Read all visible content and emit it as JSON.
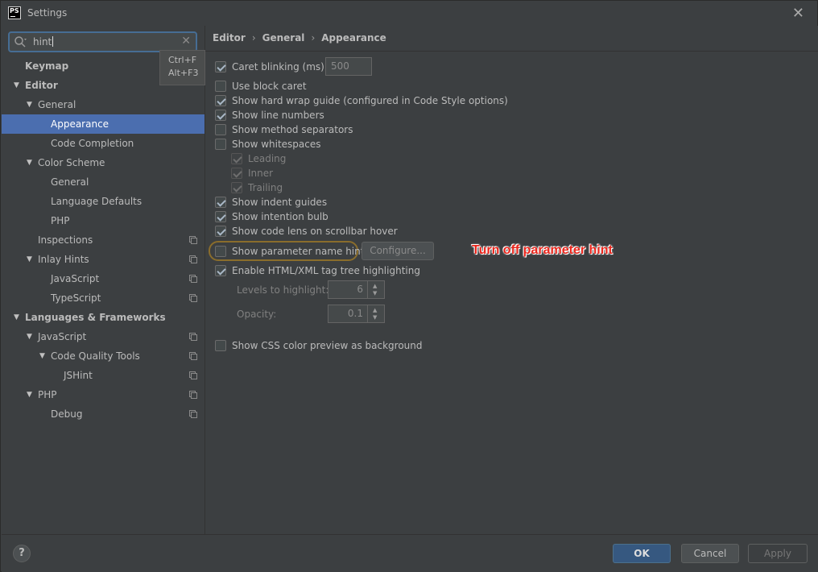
{
  "window": {
    "title": "Settings",
    "app_icon_text": "PS"
  },
  "search": {
    "value": "hint",
    "shortcut_1": "Ctrl+F",
    "shortcut_2": "Alt+F3"
  },
  "tree": [
    {
      "label": "Keymap",
      "depth": 0,
      "bold": true,
      "arrow": "",
      "copy": false,
      "selected": false
    },
    {
      "label": "Editor",
      "depth": 0,
      "bold": true,
      "arrow": "down",
      "copy": false,
      "selected": false
    },
    {
      "label": "General",
      "depth": 1,
      "bold": false,
      "arrow": "down",
      "copy": false,
      "selected": false
    },
    {
      "label": "Appearance",
      "depth": 2,
      "bold": false,
      "arrow": "",
      "copy": false,
      "selected": true
    },
    {
      "label": "Code Completion",
      "depth": 2,
      "bold": false,
      "arrow": "",
      "copy": false,
      "selected": false
    },
    {
      "label": "Color Scheme",
      "depth": 1,
      "bold": false,
      "arrow": "down",
      "copy": false,
      "selected": false
    },
    {
      "label": "General",
      "depth": 2,
      "bold": false,
      "arrow": "",
      "copy": false,
      "selected": false
    },
    {
      "label": "Language Defaults",
      "depth": 2,
      "bold": false,
      "arrow": "",
      "copy": false,
      "selected": false
    },
    {
      "label": "PHP",
      "depth": 2,
      "bold": false,
      "arrow": "",
      "copy": false,
      "selected": false
    },
    {
      "label": "Inspections",
      "depth": 1,
      "bold": false,
      "arrow": "",
      "copy": true,
      "selected": false
    },
    {
      "label": "Inlay Hints",
      "depth": 1,
      "bold": false,
      "arrow": "down",
      "copy": true,
      "selected": false
    },
    {
      "label": "JavaScript",
      "depth": 2,
      "bold": false,
      "arrow": "",
      "copy": true,
      "selected": false
    },
    {
      "label": "TypeScript",
      "depth": 2,
      "bold": false,
      "arrow": "",
      "copy": true,
      "selected": false
    },
    {
      "label": "Languages & Frameworks",
      "depth": 0,
      "bold": true,
      "arrow": "down",
      "copy": false,
      "selected": false
    },
    {
      "label": "JavaScript",
      "depth": 1,
      "bold": false,
      "arrow": "down",
      "copy": true,
      "selected": false
    },
    {
      "label": "Code Quality Tools",
      "depth": 2,
      "bold": false,
      "arrow": "down",
      "copy": true,
      "selected": false
    },
    {
      "label": "JSHint",
      "depth": 3,
      "bold": false,
      "arrow": "",
      "copy": true,
      "selected": false
    },
    {
      "label": "PHP",
      "depth": 1,
      "bold": false,
      "arrow": "down",
      "copy": true,
      "selected": false
    },
    {
      "label": "Debug",
      "depth": 2,
      "bold": false,
      "arrow": "",
      "copy": true,
      "selected": false
    }
  ],
  "breadcrumb": {
    "part1": "Editor",
    "part2": "General",
    "part3": "Appearance",
    "separator": "›"
  },
  "options": {
    "caret_blinking": {
      "label": "Caret blinking (ms):",
      "checked": true,
      "value": "500"
    },
    "block_caret": {
      "label": "Use block caret",
      "checked": false
    },
    "hard_wrap": {
      "label": "Show hard wrap guide (configured in Code Style options)",
      "checked": true
    },
    "line_numbers": {
      "label": "Show line numbers",
      "checked": true
    },
    "method_separators": {
      "label": "Show method separators",
      "checked": false
    },
    "whitespaces": {
      "label": "Show whitespaces",
      "checked": false
    },
    "leading": {
      "label": "Leading",
      "checked": true
    },
    "inner": {
      "label": "Inner",
      "checked": true
    },
    "trailing": {
      "label": "Trailing",
      "checked": true
    },
    "indent_guides": {
      "label": "Show indent guides",
      "checked": true
    },
    "intention_bulb": {
      "label": "Show intention bulb",
      "checked": true
    },
    "code_lens": {
      "label": "Show code lens on scrollbar hover",
      "checked": true
    },
    "param_hints": {
      "label": "Show parameter name hints",
      "checked": false,
      "configure_label": "Configure..."
    },
    "tag_tree": {
      "label": "Enable HTML/XML tag tree highlighting",
      "checked": true
    },
    "levels": {
      "label": "Levels to highlight:",
      "value": "6"
    },
    "opacity": {
      "label": "Opacity:",
      "value": "0.1"
    },
    "css_color": {
      "label": "Show CSS color preview as background",
      "checked": false
    }
  },
  "annotation": {
    "text": "Turn off parameter hint",
    "color": "#e8261c"
  },
  "footer": {
    "help": "?",
    "ok": "OK",
    "cancel": "Cancel",
    "apply": "Apply"
  },
  "colors": {
    "selection": "#4b6eaf",
    "background": "#3c3f41",
    "ok_button": "#365880"
  }
}
